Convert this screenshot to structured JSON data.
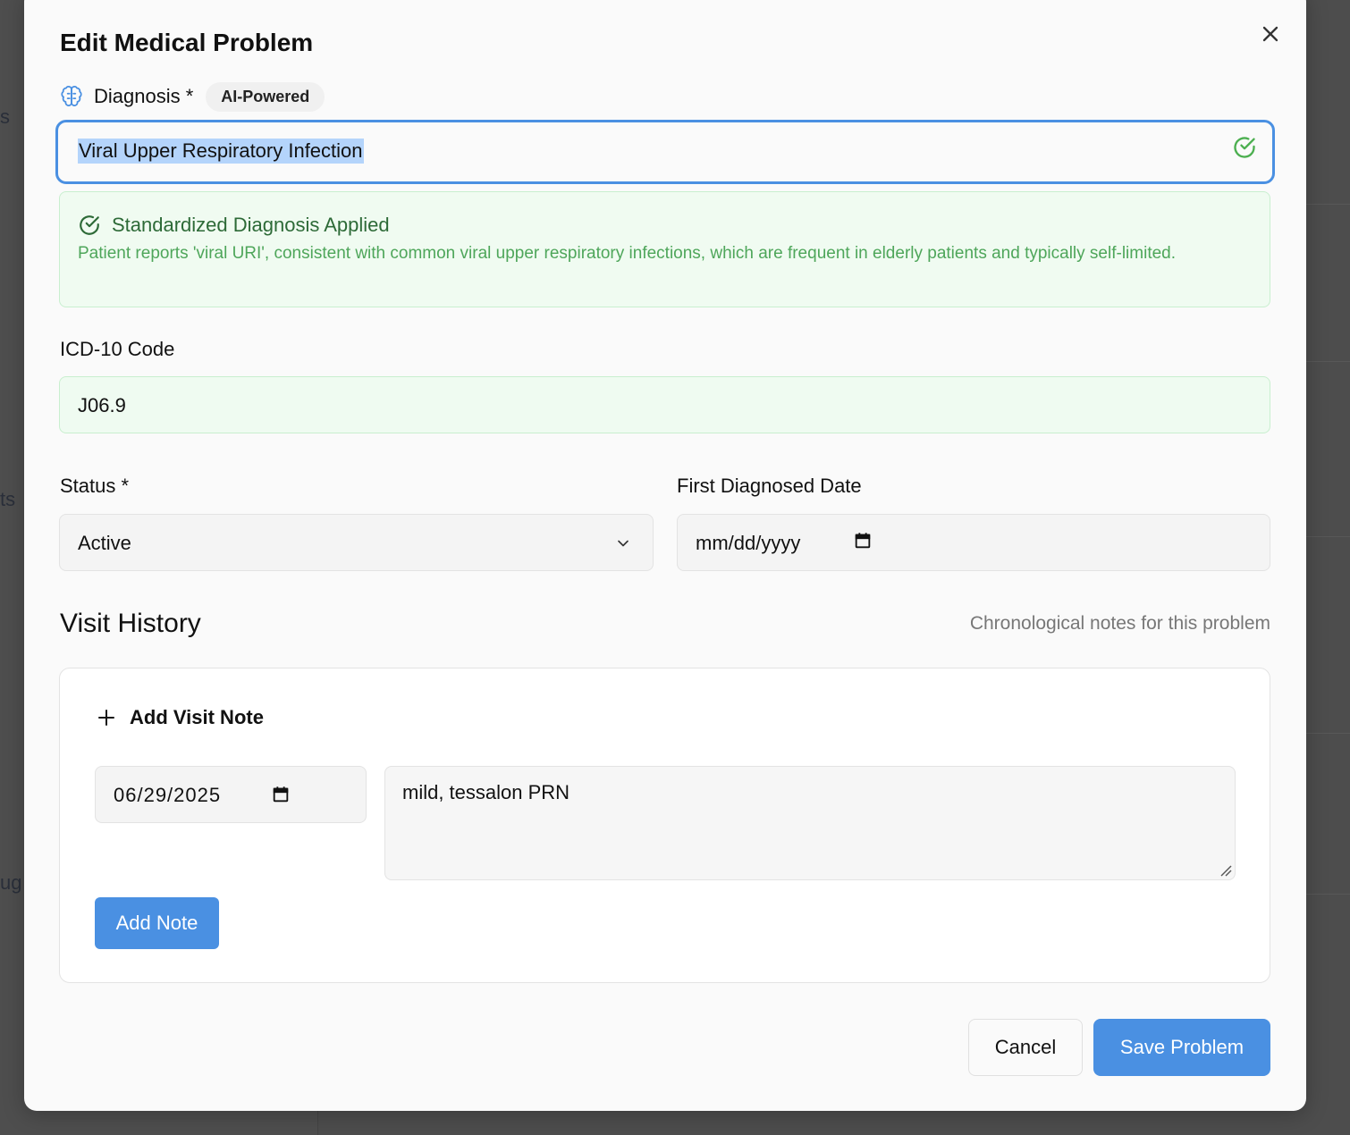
{
  "background": {
    "fragments": [
      "s",
      "ts",
      "ug"
    ]
  },
  "dialog": {
    "title": "Edit Medical Problem",
    "diagnosis": {
      "label": "Diagnosis *",
      "badge": "AI-Powered",
      "value": "Viral Upper Respiratory Infection"
    },
    "standardized": {
      "title": "Standardized Diagnosis Applied",
      "description": "Patient reports 'viral URI', consistent with common viral upper respiratory infections, which are frequent in elderly patients and typically self-limited."
    },
    "icd": {
      "label": "ICD-10 Code",
      "value": "J06.9"
    },
    "status": {
      "label": "Status *",
      "value": "Active"
    },
    "first_diagnosed": {
      "label": "First Diagnosed Date",
      "placeholder": "mm/dd/yyyy"
    },
    "visit_history": {
      "title": "Visit History",
      "subtitle": "Chronological notes for this problem",
      "add_label": "Add Visit Note",
      "note_date": "06/29/2025",
      "note_text": "mild, tessalon PRN",
      "add_button": "Add Note"
    },
    "footer": {
      "cancel": "Cancel",
      "save": "Save Problem"
    }
  },
  "colors": {
    "accent": "#4a90e2",
    "success_text": "#2d6a37",
    "success_bg": "#f0fbf1",
    "selection": "#b4d4fb"
  }
}
